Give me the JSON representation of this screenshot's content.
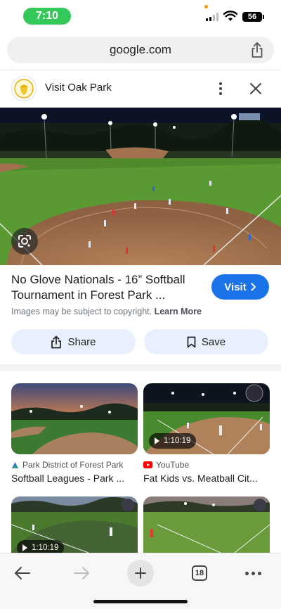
{
  "status": {
    "time": "7:10",
    "battery": "56"
  },
  "browser": {
    "url": "google.com"
  },
  "source": {
    "name": "Visit Oak Park",
    "logo_text": "OAK PARK"
  },
  "result": {
    "title": "No Glove Nationals - 16” Softball Tournament in Forest Park ...",
    "visit_label": "Visit",
    "copyright_text": "Images may be subject to copyright.",
    "learn_more": "Learn More",
    "share_label": "Share",
    "save_label": "Save"
  },
  "related": [
    {
      "source": "Park District of Forest Park",
      "caption": "Softball Leagues - Park ...",
      "duration": ""
    },
    {
      "source": "YouTube",
      "caption": "Fat Kids vs. Meatball Cit...",
      "duration": "1:10:19"
    },
    {
      "source": "",
      "caption": "",
      "duration": "1:10:19"
    },
    {
      "source": "",
      "caption": "",
      "duration": ""
    }
  ],
  "toolbar": {
    "tab_count": "18"
  },
  "colors": {
    "accent": "#1a73e8",
    "pill_green": "#34c759",
    "youtube_red": "#ff0000"
  }
}
